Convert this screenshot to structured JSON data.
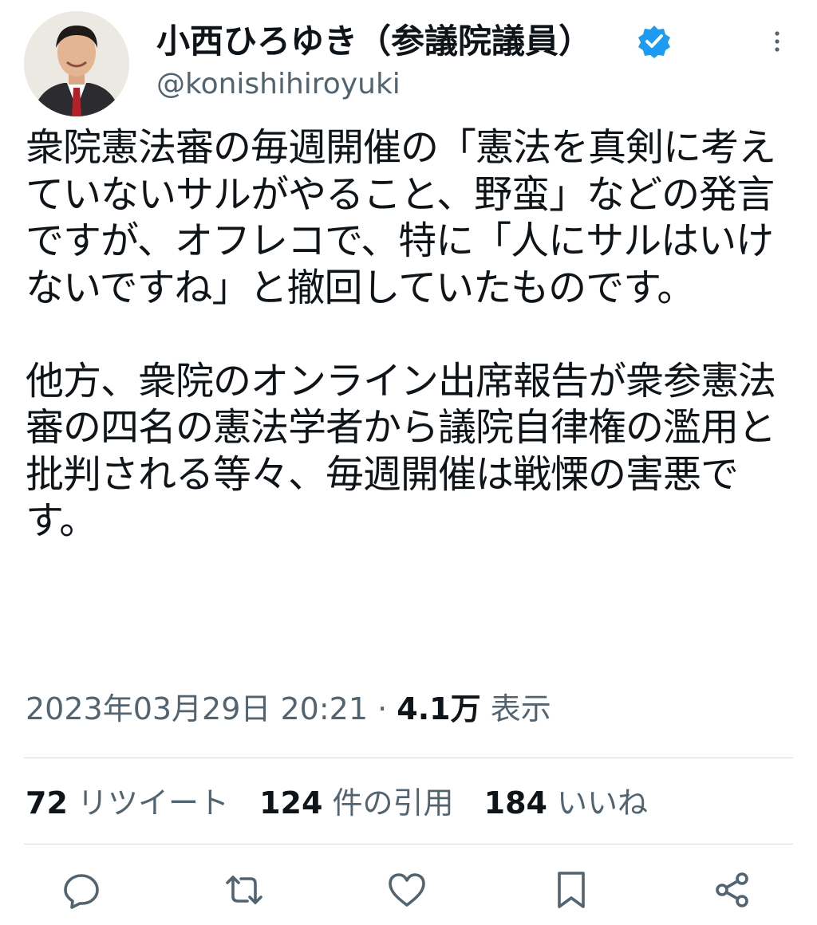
{
  "author": {
    "display_name": "小西ひろゆき（参議院議員）",
    "handle": "@konishihiroyuki"
  },
  "tweet": {
    "text": "衆院憲法審の毎週開催の「憲法を真剣に考えていないサルがやること、野蛮」などの発言ですが、オフレコで、特に「人にサルはいけないですね」と撤回していたものです。\n\n他方、衆院のオンライン出席報告が衆参憲法審の四名の憲法学者から議院自律権の濫用と批判される等々、毎週開催は戦慄の害悪です。"
  },
  "meta": {
    "timestamp": "2023年03月29日 20:21",
    "separator": "·",
    "views_count": "4.1万",
    "views_label": "表示"
  },
  "stats": {
    "retweets_count": "72",
    "retweets_label": "リツイート",
    "quotes_count": "124",
    "quotes_label": "件の引用",
    "likes_count": "184",
    "likes_label": "いいね"
  },
  "icons": {
    "verified": "verified-badge-icon",
    "more": "more-vertical-icon",
    "reply": "reply-icon",
    "retweet": "retweet-icon",
    "like": "heart-icon",
    "bookmark": "bookmark-icon",
    "share": "share-icon"
  },
  "colors": {
    "verified": "#1d9bf0",
    "text": "#0f1419",
    "secondary": "#536471",
    "divider": "#cfd9de"
  }
}
